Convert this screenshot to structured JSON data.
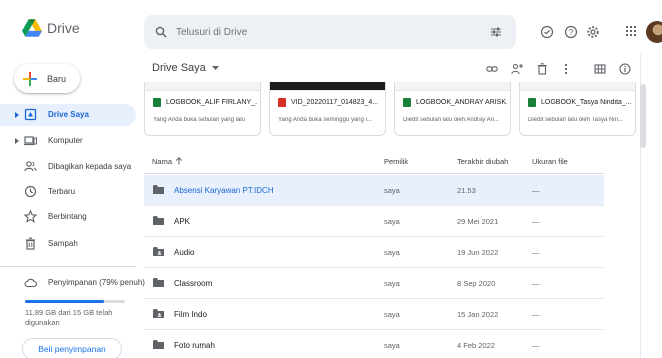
{
  "app": {
    "name": "Drive"
  },
  "search": {
    "placeholder": "Telusuri di Drive"
  },
  "sidebar": {
    "new_label": "Baru",
    "items": [
      {
        "label": "Drive Saya",
        "icon": "my-drive-icon",
        "active": true
      },
      {
        "label": "Komputer",
        "icon": "computer-icon",
        "active": false
      },
      {
        "label": "Dibagikan kepada saya",
        "icon": "shared-people-icon",
        "active": false
      },
      {
        "label": "Terbaru",
        "icon": "clock-icon",
        "active": false
      },
      {
        "label": "Berbintang",
        "icon": "star-icon",
        "active": false
      },
      {
        "label": "Sampah",
        "icon": "trash-icon",
        "active": false
      }
    ],
    "storage": {
      "label": "Penyimpanan (79% penuh)",
      "used_fraction": 0.79,
      "detail": "11,89 GB dari 15 GB telah digunakan",
      "buy_label": "Beli penyimpanan"
    }
  },
  "toolbar": {
    "breadcrumb": "Drive Saya"
  },
  "suggested": [
    {
      "title": "LOGBOOK_ALIF FIRLANY_...",
      "subtitle": "Yang Anda buka sebulan yang lalu",
      "type": "sheet"
    },
    {
      "title": "VID_20220117_014823_4...",
      "subtitle": "Yang Anda buka seminggu yang l...",
      "type": "video"
    },
    {
      "title": "LOGBOOK_ANDRAY ARISK...",
      "subtitle": "Diedit sebulan lalu oleh Andray Ari...",
      "type": "sheet"
    },
    {
      "title": "LOGBOOK_Tasya Nindita_...",
      "subtitle": "Diedit sebulan lalu oleh Tasya Nin...",
      "type": "sheet"
    }
  ],
  "table": {
    "columns": {
      "name": "Nama",
      "owner": "Pemilik",
      "modified": "Terakhir diubah",
      "size": "Ukuran file"
    },
    "rows": [
      {
        "name": "Absensi Karyawan PT.IDCH",
        "owner": "saya",
        "modified": "21.53",
        "size": "—",
        "icon": "folder-icon",
        "selected": true
      },
      {
        "name": "APK",
        "owner": "saya",
        "modified": "29 Mei 2021",
        "size": "—",
        "icon": "folder-icon",
        "selected": false
      },
      {
        "name": "Audio",
        "owner": "saya",
        "modified": "19 Jun 2022",
        "size": "—",
        "icon": "shared-folder-icon",
        "selected": false
      },
      {
        "name": "Classroom",
        "owner": "saya",
        "modified": "8 Sep 2020",
        "size": "—",
        "icon": "folder-icon",
        "selected": false
      },
      {
        "name": "Film Indo",
        "owner": "saya",
        "modified": "15 Jan 2022",
        "size": "—",
        "icon": "shared-folder-icon",
        "selected": false
      },
      {
        "name": "Foto rumah",
        "owner": "saya",
        "modified": "4 Feb 2022",
        "size": "—",
        "icon": "folder-icon",
        "selected": false
      }
    ]
  },
  "colors": {
    "accent": "#1a73e8",
    "selected_bg": "#e8f0fe",
    "sheet_green": "#188038",
    "video_red": "#d93025"
  }
}
